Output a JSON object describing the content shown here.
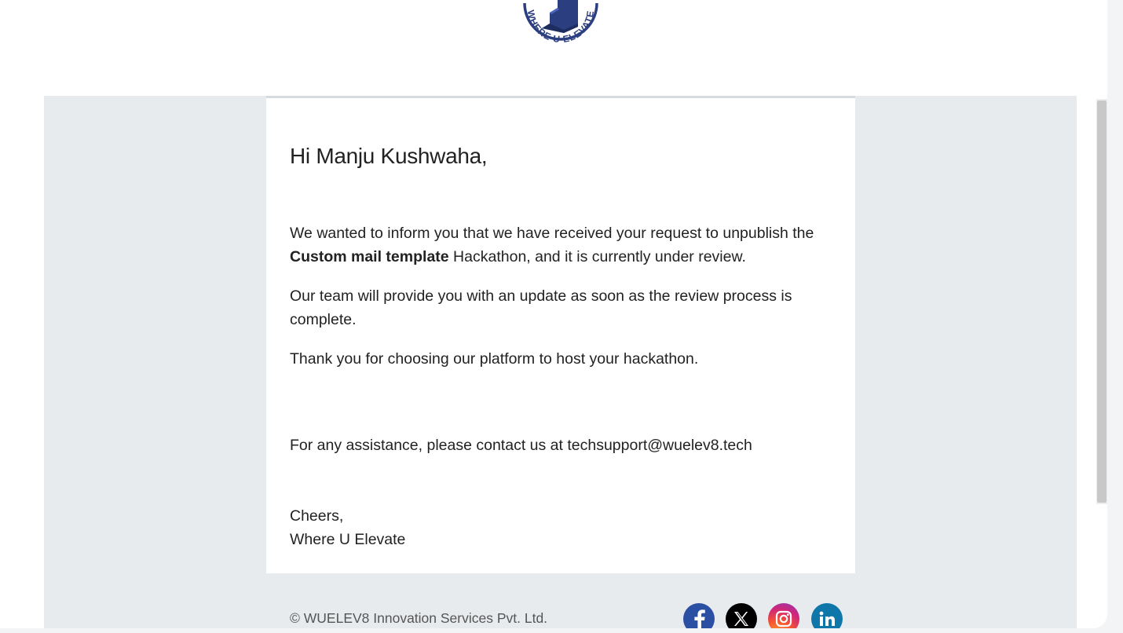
{
  "logo": {
    "text": "WHERE U ELEVATE",
    "colors": {
      "primary": "#2b3f80",
      "accent": "#3d5bb8"
    }
  },
  "email": {
    "greeting": "Hi Manju Kushwaha,",
    "paragraph1_start": "We wanted to inform you that we have received your request to unpublish the ",
    "paragraph1_bold": "Custom mail template",
    "paragraph1_end": " Hackathon, and it is currently under review.",
    "paragraph2": "Our team will provide you with an update as soon as the review process is complete.",
    "paragraph3": "Thank you for choosing our platform to host your hackathon.",
    "assistance": "For any assistance, please contact us at techsupport@wuelev8.tech",
    "signoff": "Cheers,",
    "signature": "Where U Elevate"
  },
  "footer": {
    "copyright": "© WUELEV8 Innovation Services Pvt. Ltd.",
    "social": [
      {
        "name": "facebook",
        "icon": "facebook-icon",
        "color": "#2b4fa2"
      },
      {
        "name": "x",
        "icon": "x-icon",
        "color": "#000000"
      },
      {
        "name": "instagram",
        "icon": "instagram-icon",
        "color": "#d0267a"
      },
      {
        "name": "linkedin",
        "icon": "linkedin-icon",
        "color": "#0e76a8"
      }
    ]
  }
}
